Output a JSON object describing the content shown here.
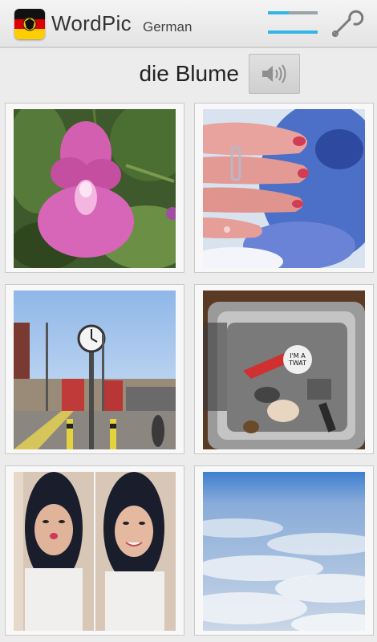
{
  "app": {
    "title": "WordPic",
    "language": "German",
    "flag_icon": "german-flag-icon"
  },
  "toolbar": {
    "menu_icon": "lines-menu-icon",
    "settings_icon": "wrench-icon"
  },
  "quiz": {
    "word": "die Blume",
    "audio_icon": "speaker-icon"
  },
  "photos": {
    "sticker_text": "I'M A TWAT",
    "items": [
      {
        "subject": "pink flower"
      },
      {
        "subject": "hand with ring on fabric"
      },
      {
        "subject": "station clock and buses"
      },
      {
        "subject": "kitchen sink with utensils"
      },
      {
        "subject": "selfie collage"
      },
      {
        "subject": "clouds from above"
      }
    ]
  },
  "colors": {
    "accent_blue": "#33b5e5",
    "toolbar_bg": "#eeeeee",
    "tile_border": "#c9c9c9"
  }
}
